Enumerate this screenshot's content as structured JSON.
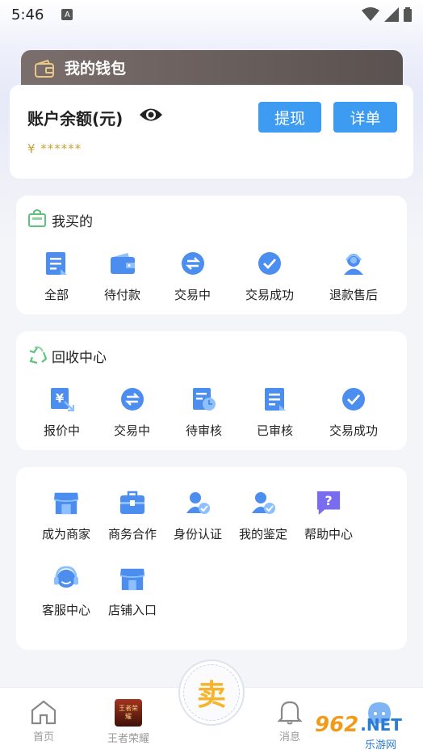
{
  "status_bar": {
    "time": "5:46",
    "a_icon": "A"
  },
  "wallet": {
    "title": "我的钱包",
    "balance_label": "账户余额(元)",
    "balance_value": "¥ ******",
    "withdraw_label": "提现",
    "detail_label": "详单"
  },
  "bought": {
    "title": "我买的",
    "items": [
      {
        "label": "全部",
        "icon": "document-icon"
      },
      {
        "label": "待付款",
        "icon": "wallet-icon"
      },
      {
        "label": "交易中",
        "icon": "exchange-icon"
      },
      {
        "label": "交易成功",
        "icon": "check-icon"
      },
      {
        "label": "退款售后",
        "icon": "service-agent-icon"
      }
    ]
  },
  "recycle": {
    "title": "回收中心",
    "items": [
      {
        "label": "报价中",
        "icon": "quote-icon"
      },
      {
        "label": "交易中",
        "icon": "exchange-icon"
      },
      {
        "label": "待审核",
        "icon": "pending-review-icon"
      },
      {
        "label": "已审核",
        "icon": "reviewed-icon"
      },
      {
        "label": "交易成功",
        "icon": "check-icon"
      }
    ]
  },
  "services": {
    "items": [
      {
        "label": "成为商家",
        "icon": "store-icon"
      },
      {
        "label": "商务合作",
        "icon": "briefcase-icon"
      },
      {
        "label": "身份认证",
        "icon": "identity-icon"
      },
      {
        "label": "我的鉴定",
        "icon": "appraisal-icon"
      },
      {
        "label": "帮助中心",
        "icon": "help-icon"
      },
      {
        "label": "客服中心",
        "icon": "headset-icon"
      },
      {
        "label": "店铺入口",
        "icon": "shop-entrance-icon"
      }
    ]
  },
  "tabbar": {
    "home": "首页",
    "game": "王者荣耀",
    "game_badge": "王者荣耀",
    "sell": "卖",
    "messages": "消息"
  },
  "watermark": {
    "brand": "962",
    "net": ".NET",
    "sub": "乐游网"
  },
  "colors": {
    "accent": "#3d9cf2",
    "icon_blue": "#4b8ef0",
    "gold": "#c9a23a"
  }
}
